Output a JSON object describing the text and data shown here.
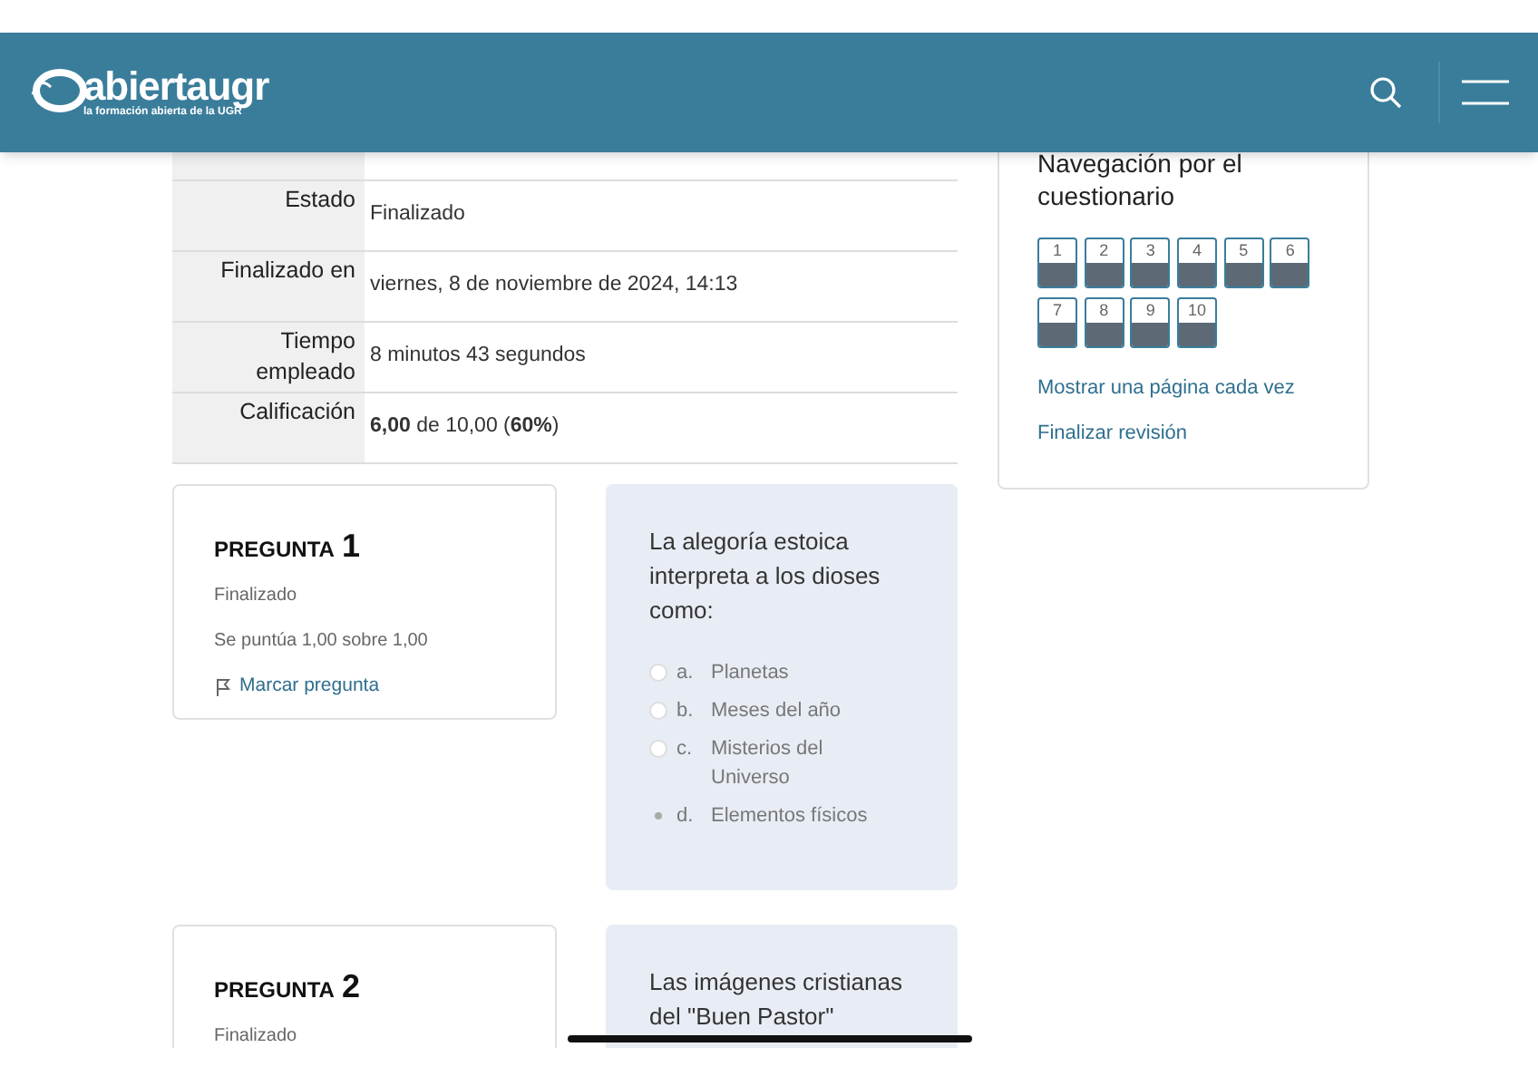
{
  "header": {
    "logo_text": "abiertaugr",
    "logo_tagline": "la formación abierta de la UGR"
  },
  "summary": [
    {
      "label": "Estado",
      "value": "Finalizado"
    },
    {
      "label": "Finalizado en",
      "value": "viernes, 8 de noviembre de 2024, 14:13"
    },
    {
      "label": "Tiempo empleado",
      "value": "8 minutos 43 segundos"
    },
    {
      "label": "Calificación",
      "value": "**6,00** de 10,00 (**60%**)"
    }
  ],
  "navigation": {
    "title": "Navegación por el cuestionario",
    "buttons": [
      {
        "label": "1",
        "answered": true
      },
      {
        "label": "2",
        "answered": true
      },
      {
        "label": "3",
        "answered": true
      },
      {
        "label": "4",
        "answered": true
      },
      {
        "label": "5",
        "answered": true
      },
      {
        "label": "6",
        "answered": true
      },
      {
        "label": "7",
        "answered": true
      },
      {
        "label": "8",
        "answered": true
      },
      {
        "label": "9",
        "answered": true
      },
      {
        "label": "10",
        "answered": true
      }
    ],
    "links": [
      "Mostrar una página cada vez",
      "Finalizar revisión"
    ]
  },
  "questions": [
    {
      "heading": "PREGUNTA",
      "number": "1",
      "status": "Finalizado",
      "score": "Se puntúa 1,00 sobre 1,00",
      "flag": "Marcar pregunta",
      "text": "La alegoría estoica interpreta a los dioses como:",
      "options": [
        {
          "letter": "a.",
          "text": "Planetas",
          "selected": false
        },
        {
          "letter": "b.",
          "text": "Meses del año",
          "selected": false
        },
        {
          "letter": "c.",
          "text": "Misterios del Universo",
          "selected": false
        },
        {
          "letter": "d.",
          "text": "Elementos físicos",
          "selected": true
        }
      ]
    },
    {
      "heading": "PREGUNTA",
      "number": "2",
      "status": "Finalizado",
      "text": "Las imágenes cristianas del \"Buen Pastor\""
    }
  ]
}
